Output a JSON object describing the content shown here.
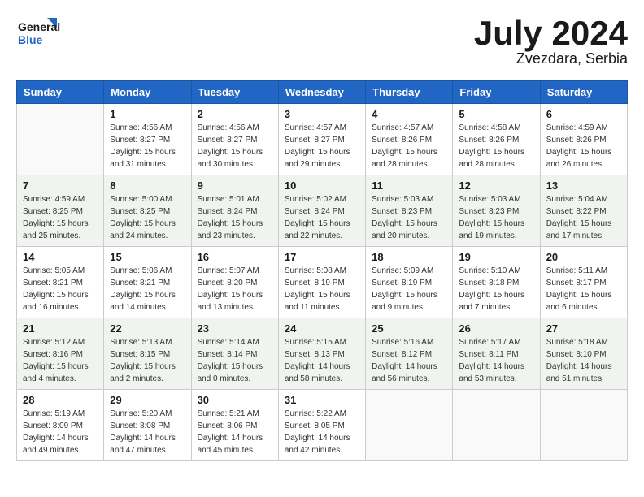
{
  "header": {
    "logo_line1": "General",
    "logo_line2": "Blue",
    "month_year": "July 2024",
    "location": "Zvezdara, Serbia"
  },
  "days_of_week": [
    "Sunday",
    "Monday",
    "Tuesday",
    "Wednesday",
    "Thursday",
    "Friday",
    "Saturday"
  ],
  "weeks": [
    [
      {
        "day": "",
        "info": ""
      },
      {
        "day": "1",
        "info": "Sunrise: 4:56 AM\nSunset: 8:27 PM\nDaylight: 15 hours\nand 31 minutes."
      },
      {
        "day": "2",
        "info": "Sunrise: 4:56 AM\nSunset: 8:27 PM\nDaylight: 15 hours\nand 30 minutes."
      },
      {
        "day": "3",
        "info": "Sunrise: 4:57 AM\nSunset: 8:27 PM\nDaylight: 15 hours\nand 29 minutes."
      },
      {
        "day": "4",
        "info": "Sunrise: 4:57 AM\nSunset: 8:26 PM\nDaylight: 15 hours\nand 28 minutes."
      },
      {
        "day": "5",
        "info": "Sunrise: 4:58 AM\nSunset: 8:26 PM\nDaylight: 15 hours\nand 28 minutes."
      },
      {
        "day": "6",
        "info": "Sunrise: 4:59 AM\nSunset: 8:26 PM\nDaylight: 15 hours\nand 26 minutes."
      }
    ],
    [
      {
        "day": "7",
        "info": "Sunrise: 4:59 AM\nSunset: 8:25 PM\nDaylight: 15 hours\nand 25 minutes."
      },
      {
        "day": "8",
        "info": "Sunrise: 5:00 AM\nSunset: 8:25 PM\nDaylight: 15 hours\nand 24 minutes."
      },
      {
        "day": "9",
        "info": "Sunrise: 5:01 AM\nSunset: 8:24 PM\nDaylight: 15 hours\nand 23 minutes."
      },
      {
        "day": "10",
        "info": "Sunrise: 5:02 AM\nSunset: 8:24 PM\nDaylight: 15 hours\nand 22 minutes."
      },
      {
        "day": "11",
        "info": "Sunrise: 5:03 AM\nSunset: 8:23 PM\nDaylight: 15 hours\nand 20 minutes."
      },
      {
        "day": "12",
        "info": "Sunrise: 5:03 AM\nSunset: 8:23 PM\nDaylight: 15 hours\nand 19 minutes."
      },
      {
        "day": "13",
        "info": "Sunrise: 5:04 AM\nSunset: 8:22 PM\nDaylight: 15 hours\nand 17 minutes."
      }
    ],
    [
      {
        "day": "14",
        "info": "Sunrise: 5:05 AM\nSunset: 8:21 PM\nDaylight: 15 hours\nand 16 minutes."
      },
      {
        "day": "15",
        "info": "Sunrise: 5:06 AM\nSunset: 8:21 PM\nDaylight: 15 hours\nand 14 minutes."
      },
      {
        "day": "16",
        "info": "Sunrise: 5:07 AM\nSunset: 8:20 PM\nDaylight: 15 hours\nand 13 minutes."
      },
      {
        "day": "17",
        "info": "Sunrise: 5:08 AM\nSunset: 8:19 PM\nDaylight: 15 hours\nand 11 minutes."
      },
      {
        "day": "18",
        "info": "Sunrise: 5:09 AM\nSunset: 8:19 PM\nDaylight: 15 hours\nand 9 minutes."
      },
      {
        "day": "19",
        "info": "Sunrise: 5:10 AM\nSunset: 8:18 PM\nDaylight: 15 hours\nand 7 minutes."
      },
      {
        "day": "20",
        "info": "Sunrise: 5:11 AM\nSunset: 8:17 PM\nDaylight: 15 hours\nand 6 minutes."
      }
    ],
    [
      {
        "day": "21",
        "info": "Sunrise: 5:12 AM\nSunset: 8:16 PM\nDaylight: 15 hours\nand 4 minutes."
      },
      {
        "day": "22",
        "info": "Sunrise: 5:13 AM\nSunset: 8:15 PM\nDaylight: 15 hours\nand 2 minutes."
      },
      {
        "day": "23",
        "info": "Sunrise: 5:14 AM\nSunset: 8:14 PM\nDaylight: 15 hours\nand 0 minutes."
      },
      {
        "day": "24",
        "info": "Sunrise: 5:15 AM\nSunset: 8:13 PM\nDaylight: 14 hours\nand 58 minutes."
      },
      {
        "day": "25",
        "info": "Sunrise: 5:16 AM\nSunset: 8:12 PM\nDaylight: 14 hours\nand 56 minutes."
      },
      {
        "day": "26",
        "info": "Sunrise: 5:17 AM\nSunset: 8:11 PM\nDaylight: 14 hours\nand 53 minutes."
      },
      {
        "day": "27",
        "info": "Sunrise: 5:18 AM\nSunset: 8:10 PM\nDaylight: 14 hours\nand 51 minutes."
      }
    ],
    [
      {
        "day": "28",
        "info": "Sunrise: 5:19 AM\nSunset: 8:09 PM\nDaylight: 14 hours\nand 49 minutes."
      },
      {
        "day": "29",
        "info": "Sunrise: 5:20 AM\nSunset: 8:08 PM\nDaylight: 14 hours\nand 47 minutes."
      },
      {
        "day": "30",
        "info": "Sunrise: 5:21 AM\nSunset: 8:06 PM\nDaylight: 14 hours\nand 45 minutes."
      },
      {
        "day": "31",
        "info": "Sunrise: 5:22 AM\nSunset: 8:05 PM\nDaylight: 14 hours\nand 42 minutes."
      },
      {
        "day": "",
        "info": ""
      },
      {
        "day": "",
        "info": ""
      },
      {
        "day": "",
        "info": ""
      }
    ]
  ]
}
